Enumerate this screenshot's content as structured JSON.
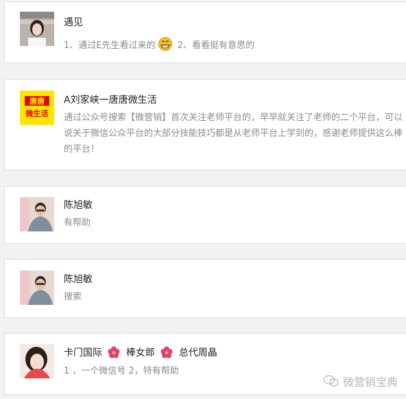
{
  "comments": [
    {
      "name": "遇见",
      "text_a": "1、通过E先生看过来的",
      "text_b": "2、看看挺有意思的"
    },
    {
      "name": "A刘家峡一唐唐微生活",
      "text": "通过公众号搜索【微营销】首次关注老师平台的，早早就关注了老师的二个平台，可以说关于微信公众平台的大部分技能技巧都是从老师平台上学到的，感谢老师提供这么棒的平台！",
      "avatar_text_top": "唐唐",
      "avatar_text_bottom": "微生活"
    },
    {
      "name": "陈旭敏",
      "text": "有帮助"
    },
    {
      "name": "陈旭敏",
      "text": "搜索"
    },
    {
      "name_a": "卡门国际",
      "name_b": "棒女郎",
      "name_c": "总代周晶",
      "text": "1 ，一个微信号 2，特有帮助"
    }
  ],
  "watermark": "微营销宝典",
  "icons": {
    "emoji": "grin-emoji-icon",
    "flower": "hibiscus-flower-icon",
    "watermark": "wechat-logo-icon"
  },
  "colors": {
    "avatar_yellow": "#ffe600",
    "avatar_red": "#e60012",
    "text_gray": "#8a8a8a"
  }
}
